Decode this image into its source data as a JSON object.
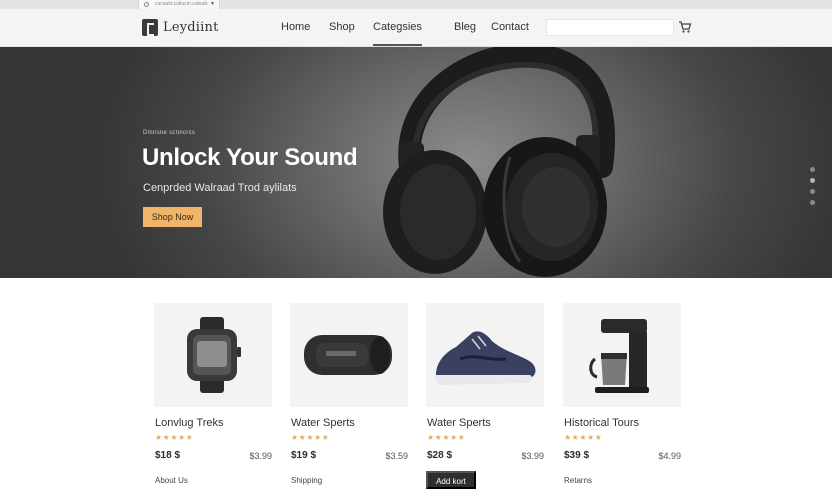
{
  "browser": {
    "tab_title": "cucuukt.cukucm.cukuck"
  },
  "navbar": {
    "logo_text": "Leydiint",
    "links": [
      {
        "label": "Home"
      },
      {
        "label": "Shop"
      },
      {
        "label": "Categsies"
      },
      {
        "label": "Bleg"
      },
      {
        "label": "Contact"
      }
    ],
    "active_link": "Categsies",
    "search_placeholder": "",
    "icons": [
      "logo-mark-icon",
      "cart-icon"
    ]
  },
  "hero": {
    "eyebrow": "Dmnsne scnncrcs",
    "title": "Unlock Your Sound",
    "subtitle": "Cenprded Walraad Trod aylilats",
    "cta_label": "Shop Now",
    "slide_count": 4,
    "active_slide": 2,
    "colors": {
      "cta": "#f0b56a",
      "background": "#4a4a4a"
    }
  },
  "products": [
    {
      "name": "Lonvlug Treks",
      "stars": "★★★★★",
      "price": "$18 $",
      "old_price": "$3.99",
      "footer": "About Us",
      "image": "smartwatch"
    },
    {
      "name": "Water Sperts",
      "stars": "★★★★★",
      "price": "$19 $",
      "old_price": "$3.59",
      "footer": "Shipping",
      "image": "bluetooth-speaker"
    },
    {
      "name": "Water Sperts",
      "stars": "★★★★★",
      "price": "$28 $",
      "old_price": "$3.99",
      "button": "Add kort",
      "image": "running-shoe"
    },
    {
      "name": "Historical Tours",
      "stars": "★★★★★",
      "price": "$39 $",
      "old_price": "$4.99",
      "footer": "Retarns",
      "image": "coffee-maker"
    }
  ]
}
